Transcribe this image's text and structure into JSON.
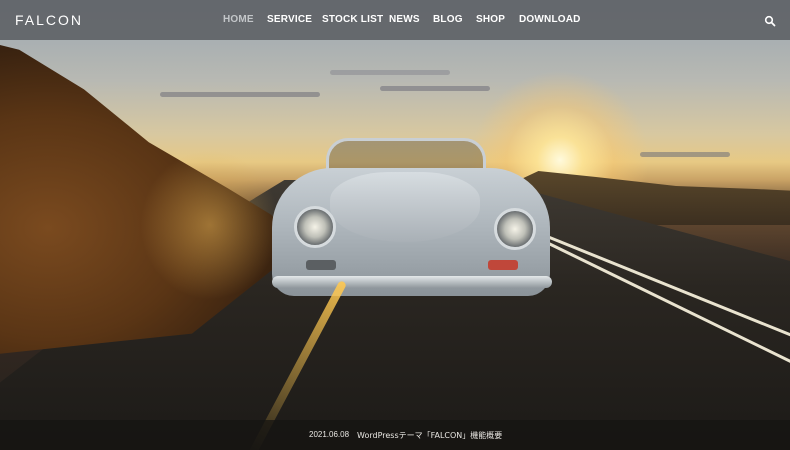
{
  "header": {
    "logo": "FALCON",
    "nav": [
      {
        "label": "HOME",
        "active": true
      },
      {
        "label": "SERVICE",
        "active": false
      },
      {
        "label": "STOCK LIST",
        "active": false
      },
      {
        "label": "NEWS",
        "active": false
      },
      {
        "label": "BLOG",
        "active": false
      },
      {
        "label": "SHOP",
        "active": false
      },
      {
        "label": "DOWNLOAD",
        "active": false
      }
    ],
    "search_icon": "search-icon"
  },
  "hero": {
    "image": "vintage convertible car driving on road at sunset"
  },
  "news": {
    "date": "2021.06.08",
    "title": "WordPressテーマ「FALCON」機能概要"
  },
  "colors": {
    "header_bg": "#5f6367",
    "nav_text": "#ffffff",
    "nav_active": "#c3c6c9",
    "newsbar_bg": "#161412"
  }
}
